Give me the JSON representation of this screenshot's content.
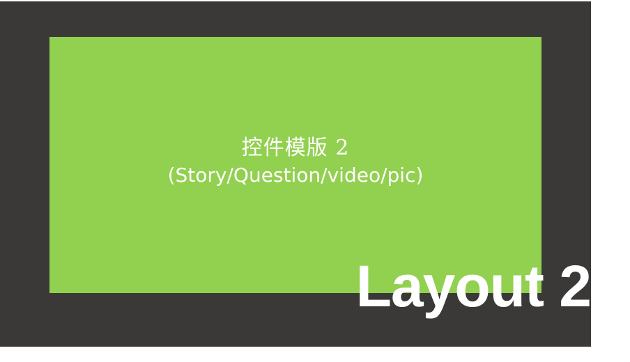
{
  "slide": {
    "panel_title": "控件模版 2",
    "panel_subtitle": "(Story/Question/video/pic)",
    "layout_label": "Layout 2"
  },
  "colors": {
    "stage_background": "#3a3938",
    "panel_fill": "#92d050",
    "text": "#ffffff"
  }
}
